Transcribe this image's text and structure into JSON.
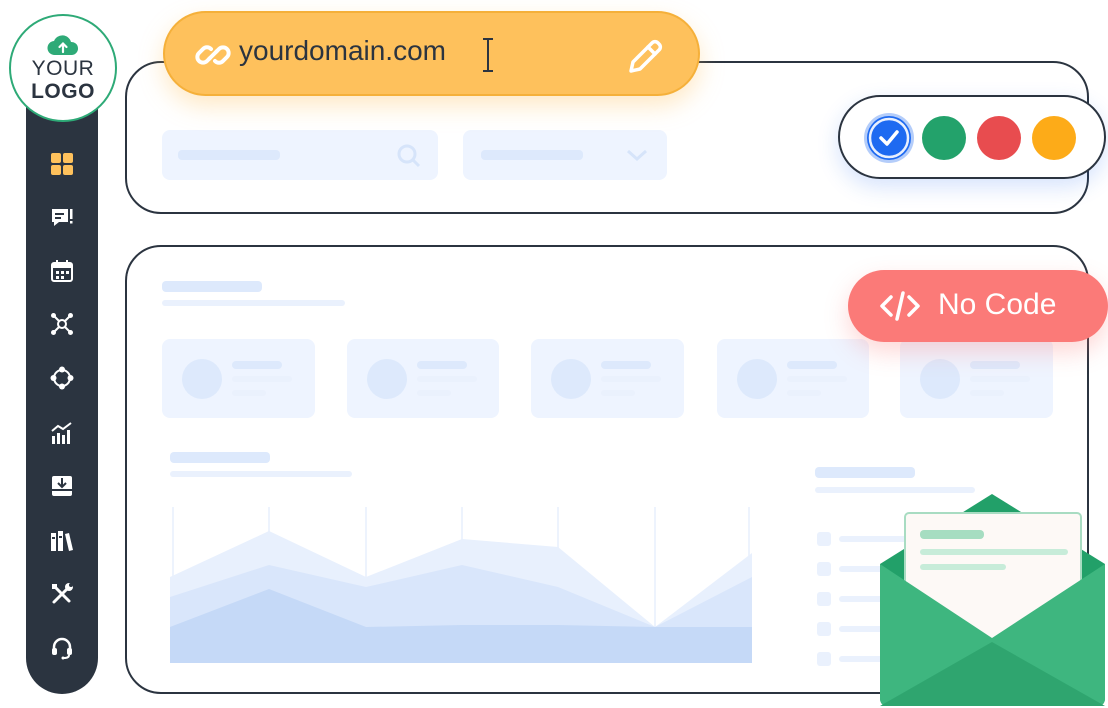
{
  "logo": {
    "line1": "YOUR",
    "line2": "LOGO"
  },
  "sidebar": {
    "items": [
      {
        "icon": "dashboard-grid-icon"
      },
      {
        "icon": "chat-message-icon"
      },
      {
        "icon": "calendar-icon"
      },
      {
        "icon": "network-nodes-icon"
      },
      {
        "icon": "pipeline-circle-icon"
      },
      {
        "icon": "chart-analytics-icon"
      },
      {
        "icon": "inbox-download-icon"
      },
      {
        "icon": "library-books-icon"
      },
      {
        "icon": "tools-icon"
      },
      {
        "icon": "headset-support-icon"
      }
    ]
  },
  "domain": {
    "text": "yourdomain.com"
  },
  "colors": {
    "swatches": [
      "#1e6af1",
      "#23a26b",
      "#e84c4f",
      "#fdab18"
    ],
    "selected": 0
  },
  "badge": {
    "label": "No Code"
  }
}
